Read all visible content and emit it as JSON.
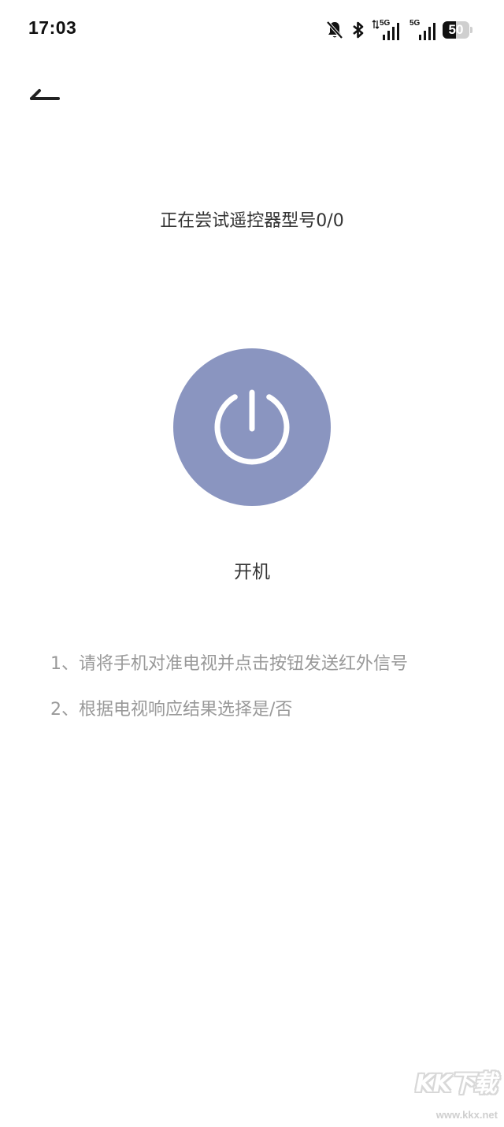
{
  "status_bar": {
    "time": "17:03",
    "network1_label": "5G",
    "network2_label": "5G",
    "battery_level": "50",
    "battery_fraction": 0.5
  },
  "nav": {
    "back_icon": "back-arrow-icon"
  },
  "main": {
    "status_text": "正在尝试遥控器型号0/0",
    "power_icon": "power-icon",
    "power_color": "#8A95C0",
    "power_label": "开机",
    "instructions": [
      "1、请将手机对准电视并点击按钮发送红外信号",
      "2、根据电视响应结果选择是/否"
    ]
  },
  "watermark": {
    "logo": "KK下载",
    "url": "www.kkx.net"
  }
}
